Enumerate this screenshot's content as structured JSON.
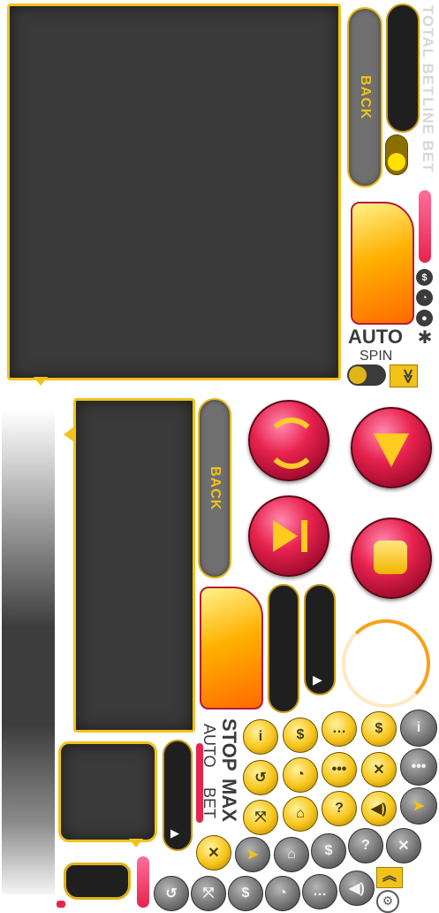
{
  "labels": {
    "total_bet": "TOTAL BET",
    "line_bet": "LINE BET",
    "back_1": "BACK",
    "back_2": "BACK",
    "auto": "AUTO",
    "spin": "SPIN",
    "stop": "STOP",
    "auto_small": "AUTO",
    "max": "MAX",
    "bet": "BET"
  },
  "icons": {
    "dollar": "$",
    "clock": "◔",
    "user": "●",
    "cog": "✱",
    "info": "i",
    "chat": "…",
    "question": "?",
    "more": "•••",
    "mute": "✕",
    "play": "▶",
    "chevrons": "≫"
  },
  "colors": {
    "gold": "#f2c21a",
    "panel": "#3a3a3a",
    "accent_pink": "#e8234f"
  }
}
